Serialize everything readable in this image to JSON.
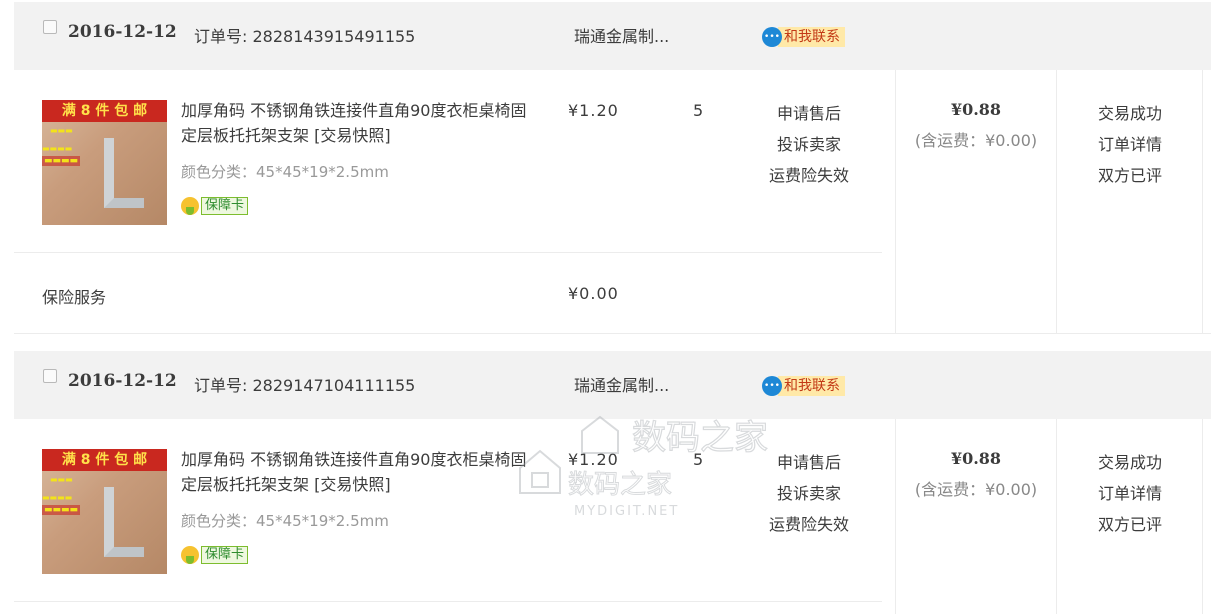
{
  "orders": [
    {
      "date": "2016-12-12",
      "order_label": "订单号: 2828143915491155",
      "shop": "瑞通金属制...",
      "contact_label": "和我联系",
      "item": {
        "thumb_banner": "满 8 件 包 邮",
        "title": "加厚角码 不锈钢角铁连接件直角90度衣柜桌椅固定层板托托架支架 [交易快照]",
        "spec": "颜色分类：45*45*19*2.5mm",
        "guarantee": "保障卡",
        "price": "¥1.20",
        "qty": "5",
        "actions": [
          "申请售后",
          "投诉卖家",
          "运费险失效"
        ]
      },
      "total": "¥0.88",
      "shipping": "(含运费：¥0.00)",
      "status": [
        "交易成功",
        "订单详情",
        "双方已评"
      ],
      "insurance": {
        "label": "保险服务",
        "price": "¥0.00"
      }
    },
    {
      "date": "2016-12-12",
      "order_label": "订单号: 2829147104111155",
      "shop": "瑞通金属制...",
      "contact_label": "和我联系",
      "item": {
        "thumb_banner": "满 8 件 包 邮",
        "title": "加厚角码 不锈钢角铁连接件直角90度衣柜桌椅固定层板托托架支架 [交易快照]",
        "spec": "颜色分类：45*45*19*2.5mm",
        "guarantee": "保障卡",
        "price": "¥1.20",
        "qty": "5",
        "actions": [
          "申请售后",
          "投诉卖家",
          "运费险失效"
        ]
      },
      "total": "¥0.88",
      "shipping": "(含运费：¥0.00)",
      "status": [
        "交易成功",
        "订单详情",
        "双方已评"
      ]
    }
  ],
  "watermark": {
    "cn": "数码之家",
    "en": "MYDIGIT.NET"
  },
  "colors": {
    "header_bg": "#f2f2f2",
    "contact_bg": "#ffe9a8",
    "contact_text": "#c33a16",
    "guarantee_green": "#2e8c2e"
  }
}
